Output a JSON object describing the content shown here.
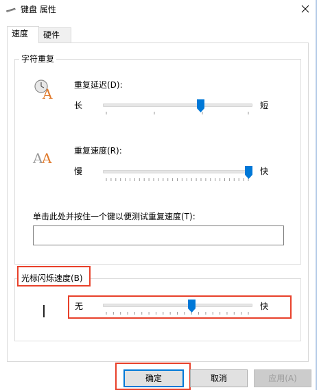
{
  "window": {
    "title": "键盘 属性",
    "close_icon": "close-icon"
  },
  "tabs": [
    {
      "label": "速度",
      "active": true
    },
    {
      "label": "硬件",
      "active": false
    }
  ],
  "repeat_group": {
    "title": "字符重复",
    "delay": {
      "label": "重复延迟(D):",
      "min_label": "长",
      "max_label": "短",
      "value_fraction": 0.66,
      "icon": "clock-letter-a-icon"
    },
    "rate": {
      "label": "重复速度(R):",
      "min_label": "慢",
      "max_label": "快",
      "value_fraction": 1.0,
      "icon": "double-letter-a-icon"
    },
    "test": {
      "label": "单击此处并按住一个键以便测试重复速度(T):",
      "value": ""
    }
  },
  "cursor_group": {
    "title": "光标闪烁速度(B)",
    "min_label": "无",
    "max_label": "快",
    "value_fraction": 0.6
  },
  "buttons": {
    "ok": "确定",
    "cancel": "取消",
    "apply": "应用(A)"
  },
  "colors": {
    "accent": "#0078d7",
    "highlight": "#e8402a"
  }
}
